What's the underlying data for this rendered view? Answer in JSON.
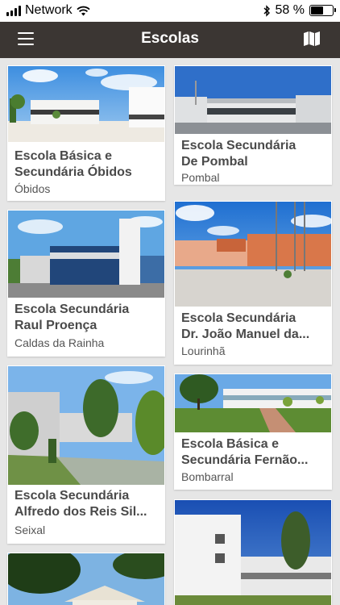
{
  "status": {
    "carrier": "Network",
    "battery": "58 %",
    "battery_level": 0.58
  },
  "nav": {
    "title": "Escolas"
  },
  "schools": [
    {
      "name": "Escola Básica e\nSecundária Óbidos",
      "town": "Óbidos"
    },
    {
      "name": "Escola Secundária\nDe Pombal",
      "town": "Pombal"
    },
    {
      "name": "Escola Secundária\nRaul Proença",
      "town": "Caldas da Rainha"
    },
    {
      "name": " Escola Secundária\nDr. João Manuel da...",
      "town": "Lourinhã"
    },
    {
      "name": "Escola Secundária\nAlfredo dos Reis Sil...",
      "town": "Seixal"
    },
    {
      "name": "Escola Básica e\nSecundária Fernão...",
      "town": "Bombarral"
    }
  ]
}
